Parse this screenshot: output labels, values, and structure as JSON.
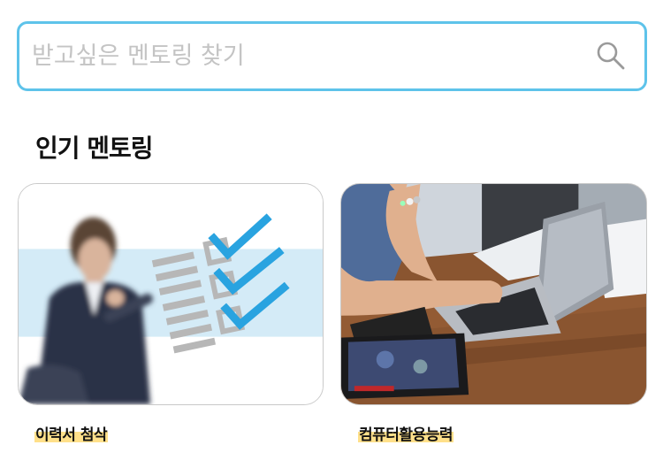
{
  "search": {
    "placeholder": "받고싶은 멘토링 찾기",
    "value": "",
    "icon": "search-icon"
  },
  "section": {
    "title": "인기 멘토링"
  },
  "cards": [
    {
      "label": "이력서 첨삭",
      "image": "resume-checklist-image"
    },
    {
      "label": "컴퓨터활용능력",
      "image": "laptop-tablet-image"
    }
  ],
  "colors": {
    "accent": "#5ec3ea",
    "highlight": "#ffe08a",
    "check": "#29a3e0"
  }
}
